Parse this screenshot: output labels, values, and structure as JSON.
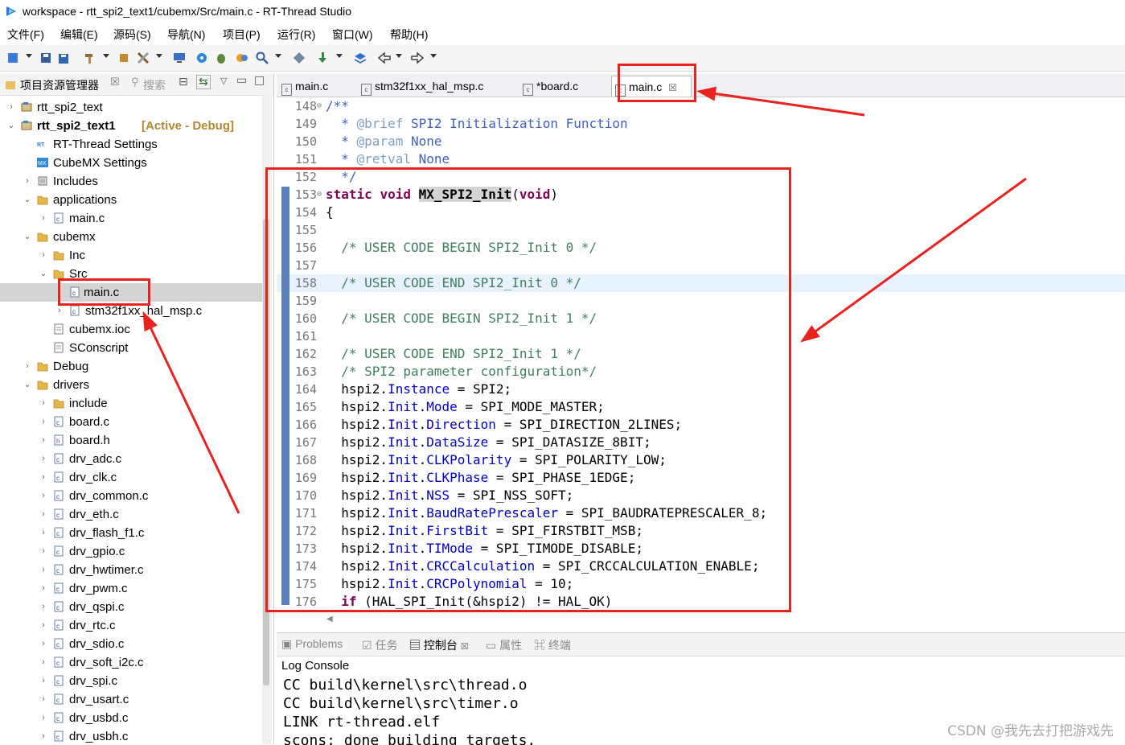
{
  "window": {
    "title": "workspace - rtt_spi2_text1/cubemx/Src/main.c - RT-Thread Studio"
  },
  "menu": [
    "文件(F)",
    "编辑(E)",
    "源码(S)",
    "导航(N)",
    "项目(P)",
    "运行(R)",
    "窗口(W)",
    "帮助(H)"
  ],
  "left_panel": {
    "tab_label": "项目资源管理器",
    "search_tab_label": "搜索",
    "tree": [
      {
        "label": "rtt_spi2_text",
        "arrow": "›",
        "icon": "project"
      },
      {
        "label": "rtt_spi2_text1",
        "suffix": "[Active - Debug]",
        "arrow": "⌄",
        "icon": "project"
      },
      {
        "label": "RT-Thread Settings",
        "arrow": "",
        "icon": "rt"
      },
      {
        "label": "CubeMX Settings",
        "arrow": "",
        "icon": "mx"
      },
      {
        "label": "Includes",
        "arrow": "›",
        "icon": "includes"
      },
      {
        "label": "applications",
        "arrow": "⌄",
        "icon": "folder"
      },
      {
        "label": "main.c",
        "arrow": "›",
        "icon": "cfile"
      },
      {
        "label": "cubemx",
        "arrow": "⌄",
        "icon": "folder"
      },
      {
        "label": "Inc",
        "arrow": "›",
        "icon": "folder"
      },
      {
        "label": "Src",
        "arrow": "⌄",
        "icon": "folder"
      },
      {
        "label": "main.c",
        "arrow": "",
        "icon": "cfile"
      },
      {
        "label": "stm32f1xx_hal_msp.c",
        "arrow": "›",
        "icon": "cfile"
      },
      {
        "label": "cubemx.ioc",
        "arrow": "",
        "icon": "file"
      },
      {
        "label": "SConscript",
        "arrow": "",
        "icon": "file"
      },
      {
        "label": "Debug",
        "arrow": "›",
        "icon": "folder"
      },
      {
        "label": "drivers",
        "arrow": "⌄",
        "icon": "folder"
      },
      {
        "label": "include",
        "arrow": "›",
        "icon": "folder"
      },
      {
        "label": "board.c",
        "arrow": "›",
        "icon": "cfile"
      },
      {
        "label": "board.h",
        "arrow": "›",
        "icon": "hfile"
      },
      {
        "label": "drv_adc.c",
        "arrow": "›",
        "icon": "cfile"
      },
      {
        "label": "drv_clk.c",
        "arrow": "›",
        "icon": "cfile"
      },
      {
        "label": "drv_common.c",
        "arrow": "›",
        "icon": "cfile"
      },
      {
        "label": "drv_eth.c",
        "arrow": "›",
        "icon": "cfile"
      },
      {
        "label": "drv_flash_f1.c",
        "arrow": "›",
        "icon": "cfile"
      },
      {
        "label": "drv_gpio.c",
        "arrow": "›",
        "icon": "cfile"
      },
      {
        "label": "drv_hwtimer.c",
        "arrow": "›",
        "icon": "cfile"
      },
      {
        "label": "drv_pwm.c",
        "arrow": "›",
        "icon": "cfile"
      },
      {
        "label": "drv_qspi.c",
        "arrow": "›",
        "icon": "cfile"
      },
      {
        "label": "drv_rtc.c",
        "arrow": "›",
        "icon": "cfile"
      },
      {
        "label": "drv_sdio.c",
        "arrow": "›",
        "icon": "cfile"
      },
      {
        "label": "drv_soft_i2c.c",
        "arrow": "›",
        "icon": "cfile"
      },
      {
        "label": "drv_spi.c",
        "arrow": "›",
        "icon": "cfile"
      },
      {
        "label": "drv_usart.c",
        "arrow": "›",
        "icon": "cfile"
      },
      {
        "label": "drv_usbd.c",
        "arrow": "›",
        "icon": "cfile"
      },
      {
        "label": "drv_usbh.c",
        "arrow": "›",
        "icon": "cfile"
      }
    ]
  },
  "editor": {
    "tabs": [
      {
        "label": "main.c"
      },
      {
        "label": "stm32f1xx_hal_msp.c"
      },
      {
        "label": "*board.c"
      },
      {
        "label": "main.c",
        "active": true,
        "close": "☒"
      }
    ],
    "lines": [
      {
        "n": "148",
        "fold": "⊖",
        "segs": [
          [
            "jd",
            "/**"
          ]
        ]
      },
      {
        "n": "149",
        "segs": [
          [
            "jd",
            "  * "
          ],
          [
            "tag",
            "@brief"
          ],
          [
            "jd",
            " SPI2 Initialization Function"
          ]
        ]
      },
      {
        "n": "150",
        "segs": [
          [
            "jd",
            "  * "
          ],
          [
            "tag",
            "@param"
          ],
          [
            "jd",
            " None"
          ]
        ]
      },
      {
        "n": "151",
        "segs": [
          [
            "jd",
            "  * "
          ],
          [
            "tag",
            "@retval"
          ],
          [
            "jd",
            " None"
          ]
        ]
      },
      {
        "n": "152",
        "segs": [
          [
            "jd",
            "  */"
          ]
        ]
      },
      {
        "n": "153",
        "fold": "⊖",
        "segs": [
          [
            "kw",
            "static"
          ],
          [
            "",
            " "
          ],
          [
            "kw",
            "void"
          ],
          [
            "",
            " "
          ],
          [
            "fnhl",
            "MX_SPI2_Init"
          ],
          [
            "",
            "("
          ],
          [
            "kw",
            "void"
          ],
          [
            "",
            ")"
          ]
        ]
      },
      {
        "n": "154",
        "segs": [
          [
            "",
            "{"
          ]
        ]
      },
      {
        "n": "155",
        "segs": [
          [
            "",
            ""
          ]
        ]
      },
      {
        "n": "156",
        "segs": [
          [
            "cmt",
            "  /* USER CODE BEGIN SPI2_Init 0 */"
          ]
        ]
      },
      {
        "n": "157",
        "segs": [
          [
            "",
            ""
          ]
        ]
      },
      {
        "n": "158",
        "hl": true,
        "segs": [
          [
            "cmt",
            "  /* USER CODE END SPI2_Init 0 */"
          ]
        ]
      },
      {
        "n": "159",
        "segs": [
          [
            "",
            ""
          ]
        ]
      },
      {
        "n": "160",
        "segs": [
          [
            "cmt",
            "  /* USER CODE BEGIN SPI2_Init 1 */"
          ]
        ]
      },
      {
        "n": "161",
        "segs": [
          [
            "",
            ""
          ]
        ]
      },
      {
        "n": "162",
        "segs": [
          [
            "cmt",
            "  /* USER CODE END SPI2_Init 1 */"
          ]
        ]
      },
      {
        "n": "163",
        "segs": [
          [
            "cmt",
            "  /* SPI2 parameter configuration*/"
          ]
        ]
      },
      {
        "n": "164",
        "segs": [
          [
            "",
            "  hspi2."
          ],
          [
            "fld",
            "Instance"
          ],
          [
            "",
            " = SPI2;"
          ]
        ]
      },
      {
        "n": "165",
        "segs": [
          [
            "",
            "  hspi2."
          ],
          [
            "fld",
            "Init"
          ],
          [
            "",
            "."
          ],
          [
            "fld",
            "Mode"
          ],
          [
            "",
            " = SPI_MODE_MASTER;"
          ]
        ]
      },
      {
        "n": "166",
        "segs": [
          [
            "",
            "  hspi2."
          ],
          [
            "fld",
            "Init"
          ],
          [
            "",
            "."
          ],
          [
            "fld",
            "Direction"
          ],
          [
            "",
            " = SPI_DIRECTION_2LINES;"
          ]
        ]
      },
      {
        "n": "167",
        "segs": [
          [
            "",
            "  hspi2."
          ],
          [
            "fld",
            "Init"
          ],
          [
            "",
            "."
          ],
          [
            "fld",
            "DataSize"
          ],
          [
            "",
            " = SPI_DATASIZE_8BIT;"
          ]
        ]
      },
      {
        "n": "168",
        "segs": [
          [
            "",
            "  hspi2."
          ],
          [
            "fld",
            "Init"
          ],
          [
            "",
            "."
          ],
          [
            "fld",
            "CLKPolarity"
          ],
          [
            "",
            " = SPI_POLARITY_LOW;"
          ]
        ]
      },
      {
        "n": "169",
        "segs": [
          [
            "",
            "  hspi2."
          ],
          [
            "fld",
            "Init"
          ],
          [
            "",
            "."
          ],
          [
            "fld",
            "CLKPhase"
          ],
          [
            "",
            " = SPI_PHASE_1EDGE;"
          ]
        ]
      },
      {
        "n": "170",
        "segs": [
          [
            "",
            "  hspi2."
          ],
          [
            "fld",
            "Init"
          ],
          [
            "",
            "."
          ],
          [
            "fld",
            "NSS"
          ],
          [
            "",
            " = SPI_NSS_SOFT;"
          ]
        ]
      },
      {
        "n": "171",
        "segs": [
          [
            "",
            "  hspi2."
          ],
          [
            "fld",
            "Init"
          ],
          [
            "",
            "."
          ],
          [
            "fld",
            "BaudRatePrescaler"
          ],
          [
            "",
            " = SPI_BAUDRATEPRESCALER_8;"
          ]
        ]
      },
      {
        "n": "172",
        "segs": [
          [
            "",
            "  hspi2."
          ],
          [
            "fld",
            "Init"
          ],
          [
            "",
            "."
          ],
          [
            "fld",
            "FirstBit"
          ],
          [
            "",
            " = SPI_FIRSTBIT_MSB;"
          ]
        ]
      },
      {
        "n": "173",
        "segs": [
          [
            "",
            "  hspi2."
          ],
          [
            "fld",
            "Init"
          ],
          [
            "",
            "."
          ],
          [
            "fld",
            "TIMode"
          ],
          [
            "",
            " = SPI_TIMODE_DISABLE;"
          ]
        ]
      },
      {
        "n": "174",
        "segs": [
          [
            "",
            "  hspi2."
          ],
          [
            "fld",
            "Init"
          ],
          [
            "",
            "."
          ],
          [
            "fld",
            "CRCCalculation"
          ],
          [
            "",
            " = SPI_CRCCALCULATION_ENABLE;"
          ]
        ]
      },
      {
        "n": "175",
        "segs": [
          [
            "",
            "  hspi2."
          ],
          [
            "fld",
            "Init"
          ],
          [
            "",
            "."
          ],
          [
            "fld",
            "CRCPolynomial"
          ],
          [
            "",
            " = 10;"
          ]
        ]
      },
      {
        "n": "176",
        "segs": [
          [
            "",
            "  "
          ],
          [
            "kw",
            "if"
          ],
          [
            "",
            " (HAL_SPI_Init(&hspi2) != HAL_OK)"
          ]
        ]
      }
    ]
  },
  "bottom_panel": {
    "tabs": [
      "Problems",
      "任务",
      "控制台",
      "属性",
      "终端"
    ],
    "active_tab": "控制台",
    "console_title": "Log Console",
    "console_lines": [
      "CC build\\kernel\\src\\thread.o",
      "CC build\\kernel\\src\\timer.o",
      "LINK rt-thread.elf",
      "scons: done building targets."
    ]
  },
  "watermark": "CSDN @我先去打把游戏先",
  "colors": {
    "annotation_red": "#e8221f",
    "comment": "#3f7f5f",
    "keyword": "#7f0055",
    "field": "#0000c0",
    "javadoc": "#3f5fbf"
  }
}
